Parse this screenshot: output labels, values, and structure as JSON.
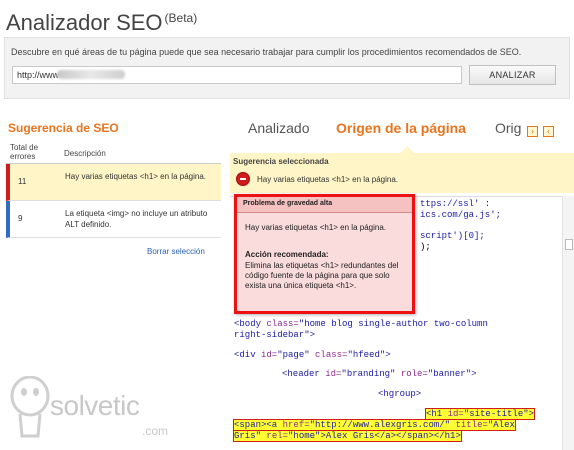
{
  "header": {
    "title": "Analizador SEO",
    "beta": "(Beta)"
  },
  "topbox": {
    "description": "Descubre en qué áreas de tu página puede que sea necesario trabajar para cumplir los procedimientos recomendados de SEO.",
    "url_value": "http://www",
    "analyze_label": "ANALIZAR"
  },
  "suggestions": {
    "title": "Sugerencia de SEO",
    "col_total": "Total de errores",
    "col_desc": "Descripción",
    "rows": [
      {
        "count": "11",
        "description": "Hay varias etiquetas <h1> en la página.",
        "color": "#d21b1b"
      },
      {
        "count": "9",
        "description": "La etiqueta <img> no incluye un atributo ALT definido.",
        "color": "#2d6fc4"
      }
    ],
    "clear_label": "Borrar selección"
  },
  "tabs": [
    {
      "label": "Analizado",
      "active": false
    },
    {
      "label": "Origen de la página",
      "active": true
    },
    {
      "label": "Orig",
      "active": false
    }
  ],
  "selected": {
    "title": "Sugerencia seleccionada",
    "text": "Hay varias etiquetas <h1> en la página."
  },
  "popup": {
    "title": "Problema de gravedad alta",
    "text": "Hay varias etiquetas <h1> en la página.",
    "rec_title": "Acción recomendada:",
    "rec_text": "Elimina las etiquetas <h1> redundantes del código fuente de la página para que solo exista una única etiqueta <h1>."
  },
  "code_lines": {
    "l1": "ttps://ssl' :",
    "l2": "ics.com/ga.js';",
    "l3": "script')[0];",
    "l4": ");",
    "body_open": "<body",
    "body_attr": " class=",
    "body_val": "\"home blog single-author two-column",
    "body_cont": "right-sidebar\"",
    "body_close": ">",
    "div_open": "<div",
    "div_attr1": " id=",
    "div_val1": "\"page\"",
    "div_attr2": " class=",
    "div_val2": "\"hfeed\"",
    "div_close": ">",
    "header_open": "<header",
    "header_attr1": " id=",
    "header_val1": "\"branding\"",
    "header_attr2": " role=",
    "header_val2": "\"banner\"",
    "header_close": ">",
    "hgroup": "<hgroup>",
    "h1_open": "<h1",
    "h1_attr": " id=",
    "h1_val": "\"site-title\"",
    "h1_close": ">",
    "span_a": "<span><a",
    "a_attr1": " href=",
    "a_val1": "\"http://www.alexgris.com/\"",
    "a_attr2": " title=",
    "a_val2": "\"Alex",
    "a_val2b": "Gris\"",
    "a_attr3": " rel=",
    "a_val3": "\"home\"",
    "a_text": ">Alex Gris</a></span></h1>"
  },
  "watermark": {
    "brand": "solvetic",
    "domain": ".com"
  }
}
